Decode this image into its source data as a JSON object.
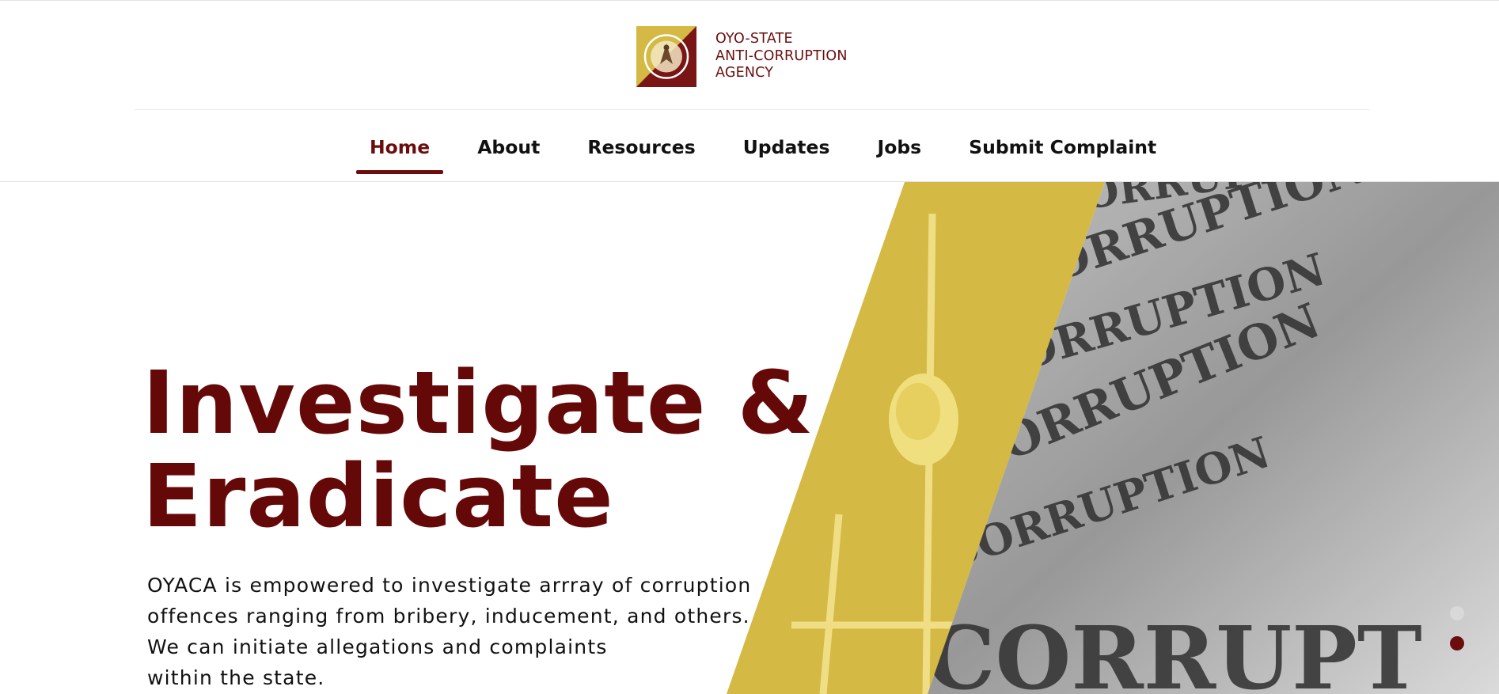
{
  "logo": {
    "lines": [
      "OYO-STATE",
      "ANTI-CORRUPTION",
      "AGENCY"
    ],
    "badge_icon": "agency-seal-icon"
  },
  "nav": {
    "items": [
      {
        "label": "Home",
        "active": true
      },
      {
        "label": "About",
        "active": false
      },
      {
        "label": "Resources",
        "active": false
      },
      {
        "label": "Updates",
        "active": false
      },
      {
        "label": "Jobs",
        "active": false
      },
      {
        "label": "Submit Complaint",
        "active": false
      }
    ]
  },
  "hero": {
    "title_line1": "Investigate &",
    "title_line2": "Eradicate",
    "desc_lines": [
      "OYACA is empowered to investigate arrray of corruption",
      "offences ranging from bribery, inducement, and others.",
      "We can initiate allegations and complaints",
      "within the state."
    ],
    "image_words": [
      "CORRUPTION",
      "CORRUPT"
    ],
    "slides": 2,
    "active_slide": 1
  },
  "colors": {
    "brand": "#6b0d0d",
    "gold": "#d4b944",
    "text": "#111111"
  }
}
